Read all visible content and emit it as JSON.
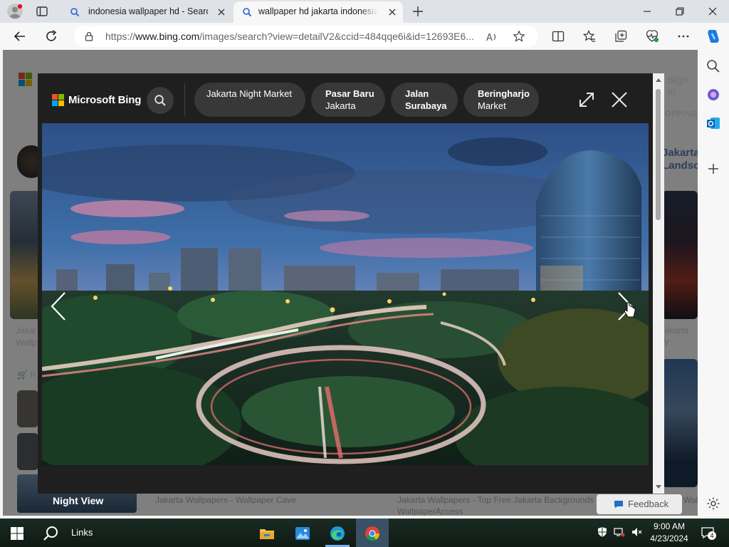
{
  "browser": {
    "tabs": [
      {
        "title": "indonesia wallpaper hd - Search"
      },
      {
        "title": "wallpaper hd jakarta indonesia - Search"
      }
    ],
    "url_prefix": "https://",
    "url_domain": "www.bing.com",
    "url_rest": "/images/search?view=detailV2&ccid=484qqe6i&id=12693E6..."
  },
  "modal": {
    "brand": "Microsoft Bing",
    "chips": [
      {
        "line1": "Jakarta Night Market",
        "line2": "",
        "bold": false
      },
      {
        "line1": "Pasar Baru",
        "line2": "Jakarta",
        "bold": true
      },
      {
        "line1": "Jalan",
        "line2": "Surabaya",
        "bold": true
      },
      {
        "line1": "Beringharjo",
        "line2": "Market",
        "bold": true
      }
    ]
  },
  "background_page": {
    "sign_in": "Sign in",
    "shopping": "OPPING",
    "right_caption_line1": "Jakarta",
    "right_caption_line2": "Landsc",
    "caption_left_1": "Jakar",
    "caption_left_2": "Wallp",
    "caption_right": "Jakarta W",
    "night_view": "Night View",
    "bottom_caption_1": "Jakarta Wallpapers - Wallpaper Cave",
    "bottom_caption_2_line1": "Jakarta Wallpapers - Top Free Jakarta Backgrounds",
    "bottom_caption_2_line2": "WallpaperAccess",
    "bottom_caption_3": "Wallp",
    "feedback": "Feedback",
    "cart_label": "R"
  },
  "taskbar": {
    "links_label": "Links",
    "time": "9:00 AM",
    "date": "4/23/2024",
    "notification_count": "4"
  },
  "colors": {
    "accent": "#0078d4",
    "modal_bg": "#1f1f1f",
    "chip_bg": "#383838"
  }
}
